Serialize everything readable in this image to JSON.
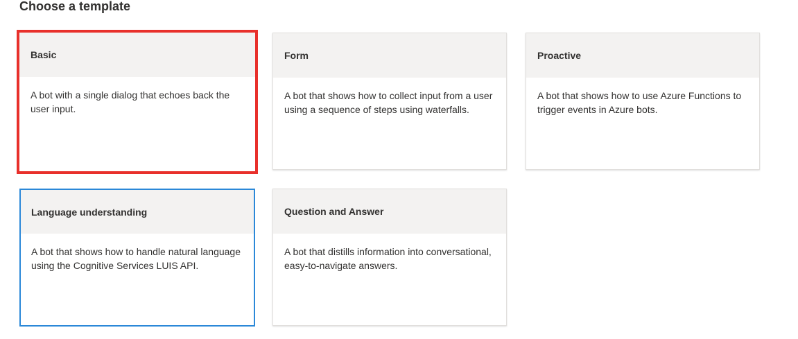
{
  "page": {
    "title": "Choose a template"
  },
  "templates": [
    {
      "title": "Basic",
      "description": "A bot with a single dialog that echoes back the user input.",
      "state": "highlighted"
    },
    {
      "title": "Form",
      "description": "A bot that shows how to collect input from a user using a sequence of steps using waterfalls.",
      "state": "default"
    },
    {
      "title": "Proactive",
      "description": "A bot that shows how to use Azure Functions to trigger events in Azure bots.",
      "state": "default"
    },
    {
      "title": "Language understanding",
      "description": "A bot that shows how to handle natural language using the Cognitive Services LUIS API.",
      "state": "selected"
    },
    {
      "title": "Question and Answer",
      "description": "A bot that distills information into conversational, easy-to-navigate answers.",
      "state": "default"
    }
  ],
  "colors": {
    "highlight": "#e8302b",
    "selected": "#2b88d8",
    "header_bg": "#f3f2f1"
  }
}
